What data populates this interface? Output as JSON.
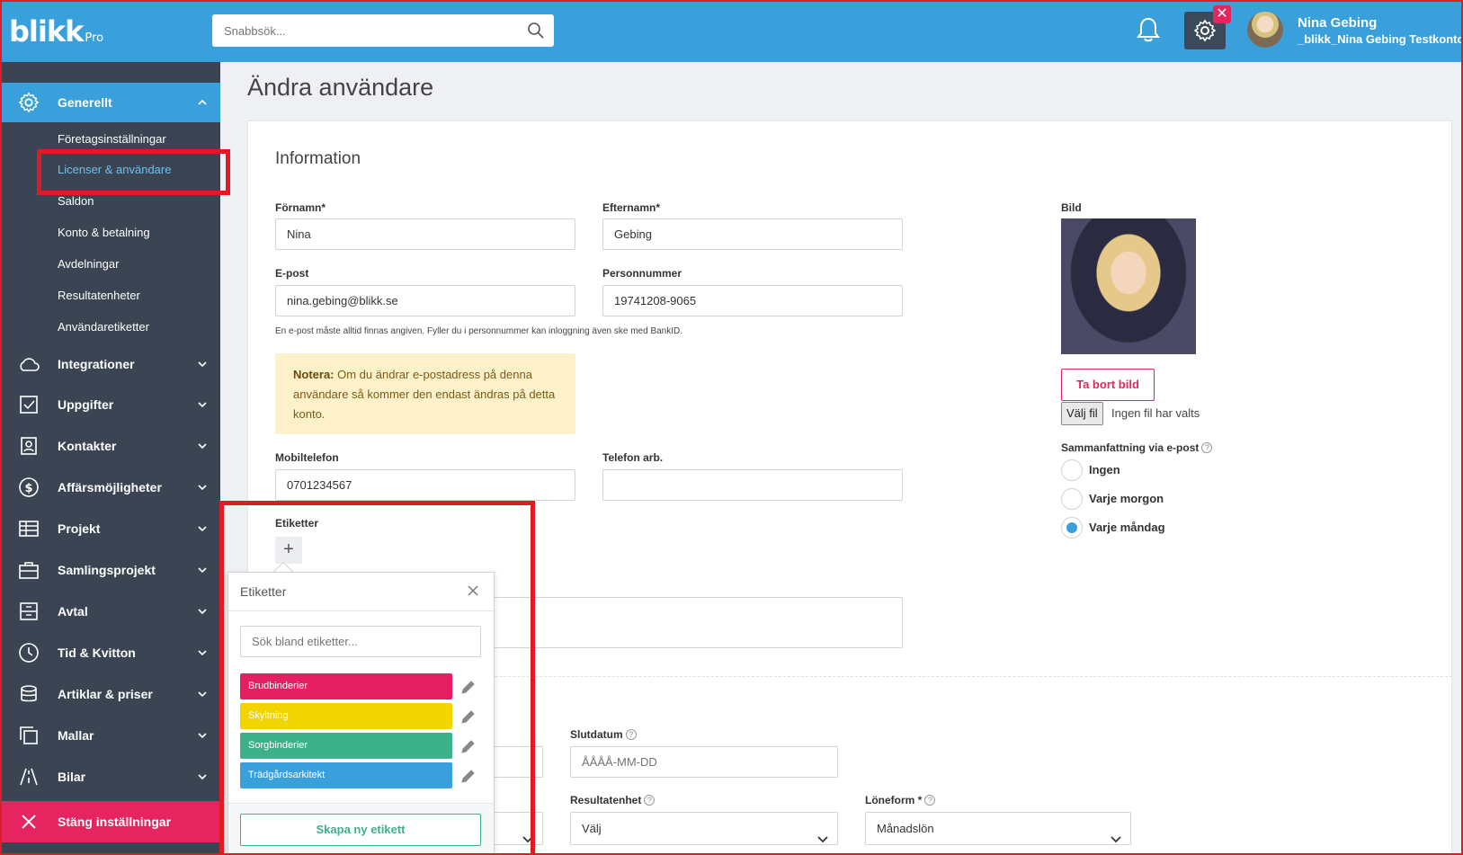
{
  "header": {
    "logo": "blikk",
    "logo_suffix": "Pro",
    "search_placeholder": "Snabbsök...",
    "gear_badge": "✕",
    "user_name": "Nina Gebing",
    "user_account": "_blikk_Nina Gebing Testkonto",
    "accent": "#3aa0dc"
  },
  "sidebar": {
    "groups": [
      {
        "label": "Generellt",
        "icon": "gear-icon",
        "active": true
      },
      {
        "label": "Integrationer",
        "icon": "cloud-icon"
      },
      {
        "label": "Uppgifter",
        "icon": "checkbox-icon"
      },
      {
        "label": "Kontakter",
        "icon": "contact-icon"
      },
      {
        "label": "Affärsmöjligheter",
        "icon": "dollar-icon"
      },
      {
        "label": "Projekt",
        "icon": "table-icon"
      },
      {
        "label": "Samlingsprojekt",
        "icon": "briefcase-icon"
      },
      {
        "label": "Avtal",
        "icon": "archive-icon"
      },
      {
        "label": "Tid & Kvitton",
        "icon": "clock-icon"
      },
      {
        "label": "Artiklar & priser",
        "icon": "coins-icon"
      },
      {
        "label": "Mallar",
        "icon": "copy-icon"
      },
      {
        "label": "Bilar",
        "icon": "road-icon"
      }
    ],
    "subitems": [
      "Företagsinställningar",
      "Licenser & användare",
      "Saldon",
      "Konto & betalning",
      "Avdelningar",
      "Resultatenheter",
      "Användaretiketter"
    ],
    "current_subitem": "Licenser & användare",
    "close_label": "Stäng inställningar"
  },
  "main": {
    "title": "Ändra användare",
    "section": "Information",
    "first_name_label": "Förnamn*",
    "first_name": "Nina",
    "last_name_label": "Efternamn*",
    "last_name": "Gebing",
    "email_label": "E-post",
    "email": "nina.gebing@blikk.se",
    "ssn_label": "Personnummer",
    "ssn": "19741208-9065",
    "hint": "En e-post måste alltid finnas angiven. Fyller du i personnummer kan inloggning även ske med BankID.",
    "note_bold": "Notera:",
    "note_text": " Om du ändrar e-postadress på denna användare så kommer den endast ändras på detta konto.",
    "mobile_label": "Mobiltelefon",
    "mobile": "0701234567",
    "work_phone_label": "Telefon arb.",
    "work_phone": "",
    "tags_label": "Etiketter",
    "add_tag": "+",
    "end_date_label": "Slutdatum",
    "end_date_placeholder": "ÅÅÅÅ-MM-DD",
    "result_unit_label": "Resultatenhet",
    "result_unit_value": "Välj",
    "salary_label": "Löneform *",
    "salary_value": "Månadslön"
  },
  "photo": {
    "label": "Bild",
    "remove": "Ta bort bild",
    "choose_file": "Välj fil",
    "no_file": "Ingen fil har valts",
    "summary_label": "Sammanfattning via e-post",
    "options": [
      "Ingen",
      "Varje morgon",
      "Varje måndag"
    ],
    "selected": "Varje måndag"
  },
  "tags_popup": {
    "title": "Etiketter",
    "search_placeholder": "Sök bland etiketter...",
    "tags": [
      {
        "name": "Brudbinderier",
        "color": "#e61f63"
      },
      {
        "name": "Skyltning",
        "color": "#f2d500"
      },
      {
        "name": "Sorgbinderier",
        "color": "#3db28a"
      },
      {
        "name": "Trädgårdsarkitekt",
        "color": "#3aa0dc"
      }
    ],
    "create": "Skapa ny etikett"
  }
}
